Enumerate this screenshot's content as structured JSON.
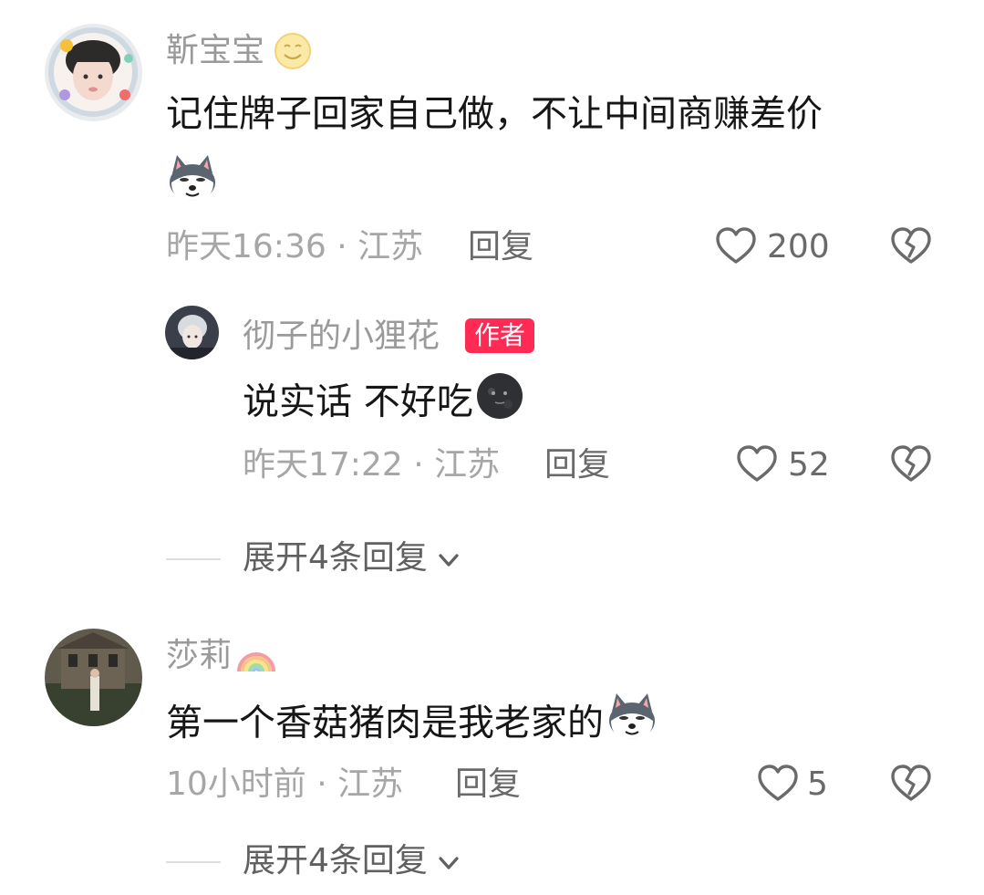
{
  "comments": [
    {
      "username": "靳宝宝",
      "text": "记住牌子回家自己做，不让中间商赚差价",
      "time_location": "昨天16:36 · 江苏",
      "reply_label": "回复",
      "like_count": "200",
      "replies": [
        {
          "username": "彻子的小狸花",
          "badge": "作者",
          "text": "说实话 不好吃",
          "time_location": "昨天17:22 · 江苏",
          "reply_label": "回复",
          "like_count": "52"
        }
      ],
      "expand_label": "展开4条回复"
    },
    {
      "username": "莎莉",
      "text": "第一个香菇猪肉是我老家的",
      "time_location": "10小时前 · 江苏",
      "reply_label": "回复",
      "like_count": "5",
      "expand_label": "展开4条回复"
    }
  ],
  "icons": {
    "name_emoji_1": "smiley-icon",
    "name_emoji_2": "rainbow-icon",
    "husky_emoji": "husky-dog-icon",
    "moon_emoji": "new-moon-face-icon",
    "like": "heart-outline-icon",
    "dislike": "broken-heart-icon",
    "expand": "chevron-down-icon"
  },
  "colors": {
    "author_badge": "#ff2b55",
    "username": "#9a9a9a",
    "meta": "#a6a6a6"
  }
}
